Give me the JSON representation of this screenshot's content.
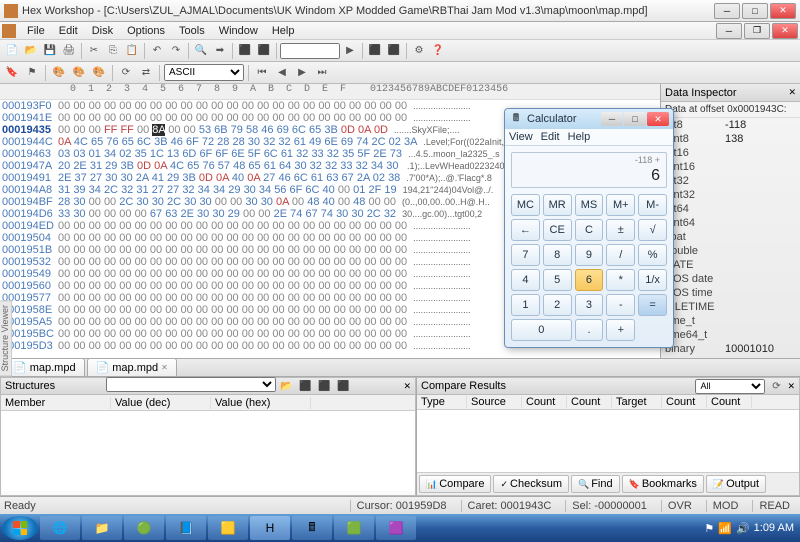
{
  "window": {
    "title": "Hex Workshop - [C:\\Users\\ZUL_AJMAL\\Documents\\UK Windom XP Modded Game\\RBThai Jam Mod v1.3\\map\\moon\\map.mpd]"
  },
  "menus": [
    "File",
    "Edit",
    "Disk",
    "Options",
    "Tools",
    "Window",
    "Help"
  ],
  "toolbar2": {
    "encoding": "ASCII"
  },
  "hex": {
    "header": "  0  1  2  3  4  5  6  7  8  9  A  B  C  D  E  F    0123456789ABCDEF0123456",
    "rows": [
      {
        "o": "000193F0",
        "b": "00 00 00 00 00 00 00 00 00 00 00 00 00 00 00 00 00 00 00 00 00 00 00",
        "a": "......................."
      },
      {
        "o": "0001941E",
        "b": "00 00 00 00 00 00 00 00 00 00 00 00 00 00 00 00 00 00 00 00 00 00 00",
        "a": "......................."
      },
      {
        "o": "00019435",
        "b": "00 00 00 FF FF 00 [8A] 00 00 53 6B 79 58 46 69 6C 65 3B 0D 0A 0D",
        "a": ".......SkyXFile;...."
      },
      {
        "o": "0001944C",
        "b": "0A 4C 65 76 65 6C 3B 46 6F 72 28 28 30 32 32 61 49 6E 69 74 2C 02 3A",
        "a": ".Level;For((022aInit,.:"
      },
      {
        "o": "00019463",
        "b": "03 03 01 34 02 35 1C 13 6D 6F 6F 6E 5F 6C 61 32 33 32 35 5F 2E 73",
        "a": "...4.5..moon_la2325_.s"
      },
      {
        "o": "0001947A",
        "b": "20 2E 31 29 3B 0D 0A 4C 65 76 57 48 65 61 64 30 32 32 33 32 34 30",
        "a": " .1);..LevWHead0223240"
      },
      {
        "o": "00019491",
        "b": "2E 37 27 30 30 2A 41 29 3B 0D 0A 40 0A 27 46 6C 61 63 67 2A 02 38",
        "a": ".7'00*A);..@.'Flacg*.8"
      },
      {
        "o": "000194A8",
        "b": "31 39 34 2C 32 31 27 27 32 34 34 29 30 34 56 6F 6C 40 00 01 2F 19",
        "a": "194,21''244)04Vol@../."
      },
      {
        "o": "000194BF",
        "b": "28 30 00 00 2C 30 30 2C 30 30 00 00 30 30 0A 00 48 40 00 48 00 00",
        "a": "(0..,00,00..00..H@.H.."
      },
      {
        "o": "000194D6",
        "b": "33 30 00 00 00 00 67 63 2E 30 30 29 00 00 2E 74 67 74 30 30 2C 32",
        "a": "30....gc.00)...tgt00,2"
      },
      {
        "o": "000194ED",
        "b": "00 00 00 00 00 00 00 00 00 00 00 00 00 00 00 00 00 00 00 00 00 00 00",
        "a": "......................."
      },
      {
        "o": "00019504",
        "b": "00 00 00 00 00 00 00 00 00 00 00 00 00 00 00 00 00 00 00 00 00 00 00",
        "a": "......................."
      },
      {
        "o": "0001951B",
        "b": "00 00 00 00 00 00 00 00 00 00 00 00 00 00 00 00 00 00 00 00 00 00 00",
        "a": "......................."
      },
      {
        "o": "00019532",
        "b": "00 00 00 00 00 00 00 00 00 00 00 00 00 00 00 00 00 00 00 00 00 00 00",
        "a": "......................."
      },
      {
        "o": "00019549",
        "b": "00 00 00 00 00 00 00 00 00 00 00 00 00 00 00 00 00 00 00 00 00 00 00",
        "a": "......................."
      },
      {
        "o": "00019560",
        "b": "00 00 00 00 00 00 00 00 00 00 00 00 00 00 00 00 00 00 00 00 00 00 00",
        "a": "......................."
      },
      {
        "o": "00019577",
        "b": "00 00 00 00 00 00 00 00 00 00 00 00 00 00 00 00 00 00 00 00 00 00 00",
        "a": "......................."
      },
      {
        "o": "0001958E",
        "b": "00 00 00 00 00 00 00 00 00 00 00 00 00 00 00 00 00 00 00 00 00 00 00",
        "a": "......................."
      },
      {
        "o": "000195A5",
        "b": "00 00 00 00 00 00 00 00 00 00 00 00 00 00 00 00 00 00 00 00 00 00 00",
        "a": "......................."
      },
      {
        "o": "000195BC",
        "b": "00 00 00 00 00 00 00 00 00 00 00 00 00 00 00 00 00 00 00 00 00 00 00",
        "a": "......................."
      },
      {
        "o": "000195D3",
        "b": "00 00 00 00 00 00 00 00 00 00 00 00 00 00 00 00 00 00 00 00 00 00 00",
        "a": "......................."
      }
    ],
    "selRow": 2
  },
  "inspector": {
    "title": "Data Inspector",
    "subtitle": "Data at offset 0x0001943C:",
    "rows": [
      {
        "k": "int8",
        "v": "-118"
      },
      {
        "k": "uint8",
        "v": "138"
      },
      {
        "k": "int16",
        "v": ""
      },
      {
        "k": "uint16",
        "v": ""
      },
      {
        "k": "int32",
        "v": ""
      },
      {
        "k": "uint32",
        "v": ""
      },
      {
        "k": "int64",
        "v": ""
      },
      {
        "k": "uint64",
        "v": ""
      },
      {
        "k": "float",
        "v": ""
      },
      {
        "k": "double",
        "v": ""
      },
      {
        "k": "DATE",
        "v": ""
      },
      {
        "k": "DOS date",
        "v": ""
      },
      {
        "k": "DOS time",
        "v": ""
      },
      {
        "k": "FILETIME",
        "v": ""
      },
      {
        "k": "time_t",
        "v": ""
      },
      {
        "k": "time64_t",
        "v": ""
      },
      {
        "k": "binary",
        "v": "10001010"
      }
    ]
  },
  "doctabs": [
    "map.mpd",
    "map.mpd"
  ],
  "struct": {
    "title": "Structures",
    "cols": [
      "Member",
      "Value (dec)",
      "Value (hex)"
    ]
  },
  "compare": {
    "title": "Compare Results",
    "filter": "All",
    "cols": [
      "Type",
      "Source",
      "Count",
      "Count",
      "Target",
      "Count",
      "Count"
    ],
    "tabs": [
      "Compare",
      "Checksum",
      "Find",
      "Bookmarks",
      "Output"
    ]
  },
  "status": {
    "ready": "Ready",
    "cursor": "Cursor: 001959D8",
    "caret": "Caret: 0001943C",
    "sel": "Sel: -00000001",
    "ovr": "OVR",
    "mod": "MOD",
    "read": "READ"
  },
  "calc": {
    "title": "Calculator",
    "menus": [
      "View",
      "Edit",
      "Help"
    ],
    "history": "-118 +",
    "result": "6",
    "buttons": [
      [
        "MC",
        "MR",
        "MS",
        "M+",
        "M-"
      ],
      [
        "←",
        "CE",
        "C",
        "±",
        "√"
      ],
      [
        "7",
        "8",
        "9",
        "/",
        "%"
      ],
      [
        "4",
        "5",
        "6",
        "*",
        "1/x"
      ],
      [
        "1",
        "2",
        "3",
        "-",
        "="
      ],
      [
        "0",
        "0",
        ".",
        "+",
        "="
      ]
    ],
    "highlight": "6"
  },
  "clock": {
    "time": "1:09 AM"
  }
}
